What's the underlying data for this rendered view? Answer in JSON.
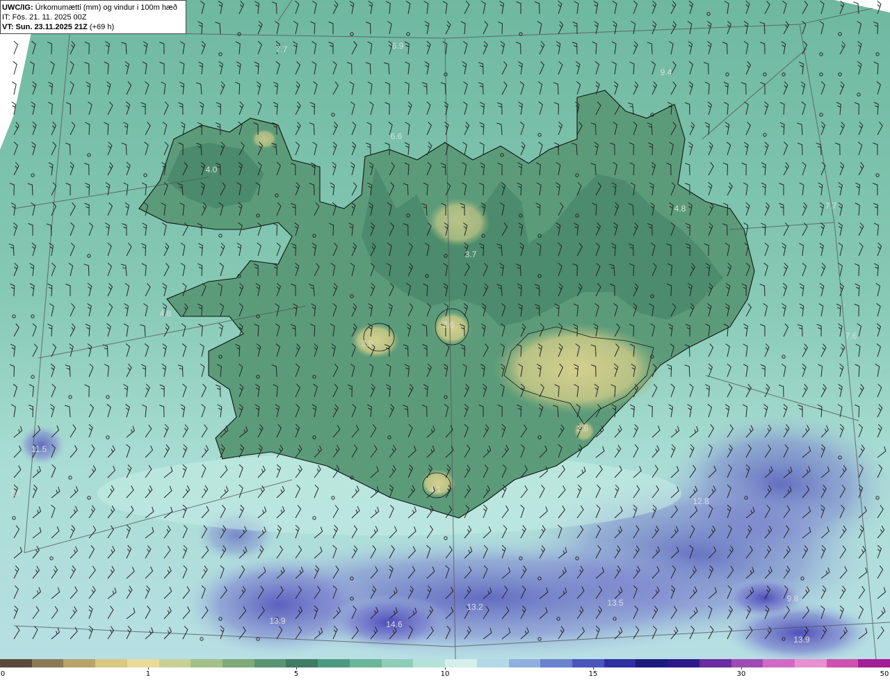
{
  "header": {
    "line1_bold": "UWC/IG:",
    "line1_text": " Úrkomumætti (mm) og vindur i 100m hæð",
    "line2": "IT: Fös. 21. 11. 2025 00Z",
    "line3_bold": "VT: Sun. 23.11.2025 21Z",
    "line3_text": " (+69 h)"
  },
  "colors": {
    "sea_light": "#a8ddd4",
    "sea_mid": "#7fc9b6",
    "land_green": "#5a9a78",
    "land_dark": "#3f7f62",
    "highland_yellow": "#c8c888",
    "precip_blue": "#7f86d0",
    "precip_dark": "#3c3ca8",
    "coast": "#111111",
    "grid": "#555555",
    "label": "#dddddd"
  },
  "value_labels": [
    {
      "text": "7.7",
      "pos": [
        405,
        75
      ]
    },
    {
      "text": "6.9",
      "pos": [
        572,
        70
      ]
    },
    {
      "text": "6.6",
      "pos": [
        570,
        200
      ]
    },
    {
      "text": "9.4",
      "pos": [
        958,
        108
      ]
    },
    {
      "text": "4.0",
      "pos": [
        304,
        248
      ]
    },
    {
      "text": "4.8",
      "pos": [
        978,
        304
      ]
    },
    {
      "text": "7.7",
      "pos": [
        1195,
        300
      ]
    },
    {
      "text": "3.7",
      "pos": [
        677,
        370
      ]
    },
    {
      "text": "4.8",
      "pos": [
        238,
        455
      ]
    },
    {
      "text": "2.6",
      "pos": [
        645,
        471
      ]
    },
    {
      "text": "3.9",
      "pos": [
        528,
        498
      ]
    },
    {
      "text": "7.6",
      "pos": [
        1224,
        487
      ]
    },
    {
      "text": "2.6",
      "pos": [
        838,
        620
      ]
    },
    {
      "text": "11.5",
      "pos": [
        56,
        650
      ]
    },
    {
      "text": "7.6",
      "pos": [
        22,
        713
      ]
    },
    {
      "text": "4.1",
      "pos": [
        626,
        708
      ]
    },
    {
      "text": "12.8",
      "pos": [
        1008,
        725
      ]
    },
    {
      "text": "13.2",
      "pos": [
        683,
        877
      ]
    },
    {
      "text": "13.5",
      "pos": [
        885,
        871
      ]
    },
    {
      "text": "13.9",
      "pos": [
        399,
        897
      ]
    },
    {
      "text": "14.6",
      "pos": [
        567,
        902
      ]
    },
    {
      "text": "13.9",
      "pos": [
        1153,
        924
      ]
    },
    {
      "text": "9.8",
      "pos": [
        1140,
        865
      ]
    }
  ],
  "colorbar": {
    "ticks": [
      "0",
      "1",
      "5",
      "10",
      "15",
      "30",
      "50"
    ],
    "stops": [
      "#5a4a3a",
      "#8a7a55",
      "#b8a46a",
      "#d8c880",
      "#e8dc9a",
      "#c8cf95",
      "#a4c089",
      "#7ea979",
      "#5a9373",
      "#3f7c63",
      "#4c9a80",
      "#6bb59a",
      "#8fcdb7",
      "#b5e2d6",
      "#d5f0ea",
      "#b3d8e8",
      "#8fb0de",
      "#6b82cf",
      "#4a55bd",
      "#2e2fa2",
      "#1c1a7e",
      "#2c1a8a",
      "#6a2ca0",
      "#a04ab4",
      "#d06ac4",
      "#e890d0",
      "#d050b0",
      "#a41c96"
    ]
  }
}
